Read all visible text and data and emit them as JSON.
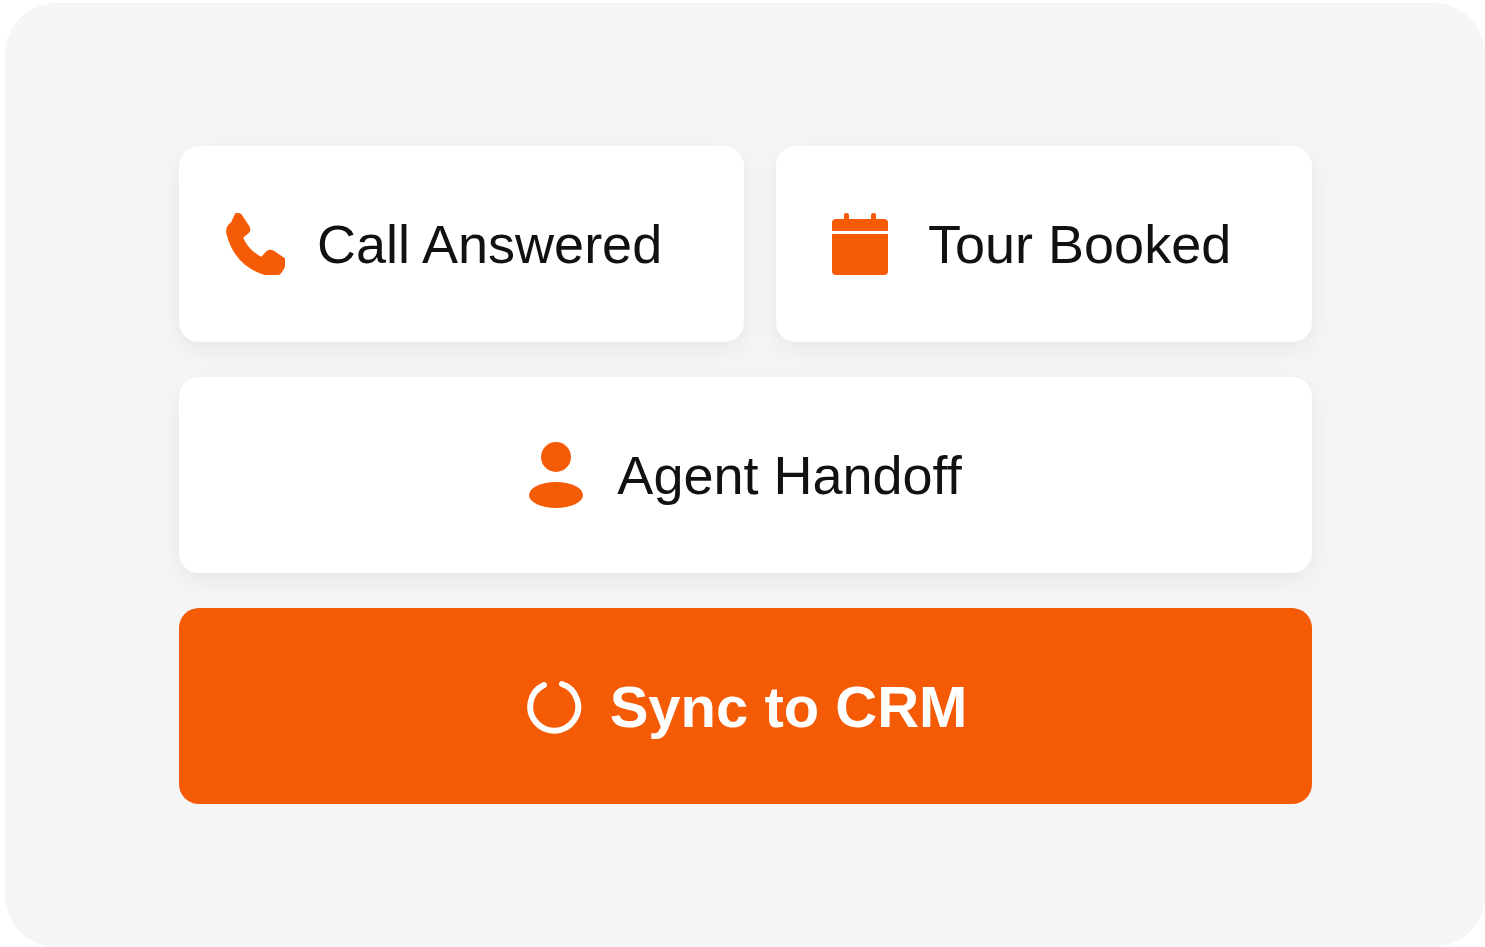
{
  "cards": [
    {
      "kind": "phone",
      "label": "Call Answered"
    },
    {
      "kind": "calendar",
      "label": "Tour Booked"
    },
    {
      "kind": "person",
      "label": "Agent Handoff"
    }
  ],
  "action": {
    "label": "Sync to CRM"
  }
}
